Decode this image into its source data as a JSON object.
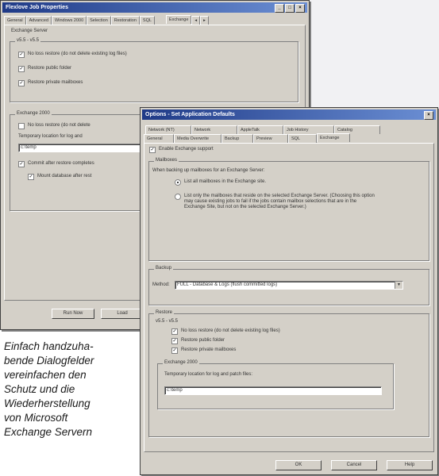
{
  "back_window": {
    "title": "Flexlove Job Properties",
    "title_buttons": [
      "_",
      "□",
      "×"
    ],
    "tabs": [
      "General",
      "Advanced",
      "Windows 2000",
      "Selection",
      "Restoration",
      "SQL",
      "Exchange",
      "◂",
      "▸"
    ],
    "server_group_label": "Exchange Server",
    "version_label": "v5.5 - v5.5",
    "checks": [
      "No loss restore (do not delete existing log files)",
      "Restore public folder",
      "Restore private mailboxes"
    ],
    "exchange2000_label": "Exchange 2000",
    "ex2000_check1": "No loss restore (do not delete",
    "ex2000_location_label": "Temporary location for log and",
    "ex2000_location_value": "c:\\temp",
    "ex2000_check2": "Commit after restore completes",
    "ex2000_check3": "Mount database after rest",
    "buttons": [
      "Run Now",
      "Load"
    ]
  },
  "front_window": {
    "title": "Options - Set Application Defaults",
    "tabs_row1": [
      "Network (NT)",
      "Network",
      "AppleTalk",
      "Job History",
      "Catalog"
    ],
    "tabs_row2": [
      "General",
      "Media Overwrite",
      "Backup",
      "Preview",
      "SQL",
      "Exchange"
    ],
    "enable_label": "Enable Exchange support",
    "mailboxes_group": "Mailboxes",
    "mailboxes_desc": "When backing up mailboxes for an Exchange Server:",
    "radio1": "List all mailboxes in the Exchange site.",
    "radio2": "List only the mailboxes that reside on the selected Exchange Server. (Choosing this option may cause existing jobs to fail if the jobs contain mailbox selections that are in the Exchange Site, but not on the selected Exchange Server.)",
    "backup_group": "Backup",
    "method_label": "Method:",
    "method_value": "FULL - Database & Logs (flush committed logs)",
    "restore_group": "Restore",
    "restore_version": "v5.5 - v5.5",
    "restore_checks": [
      "No loss restore (do not delete existing log files)",
      "Restore public folder",
      "Restore private mailboxes"
    ],
    "ex2000_group": "Exchange 2000",
    "temp_label": "Temporary location for log and patch files:",
    "temp_value": "c:\\temp",
    "buttons": [
      "OK",
      "Cancel",
      "Help"
    ],
    "close_glyph": "×"
  },
  "caption_lines": [
    "Einfach handzuha-",
    "bende Dialogfelder",
    "vereinfachen den",
    "Schutz und die",
    "Wiederherstellung",
    "von Microsoft",
    "Exchange Servern"
  ]
}
